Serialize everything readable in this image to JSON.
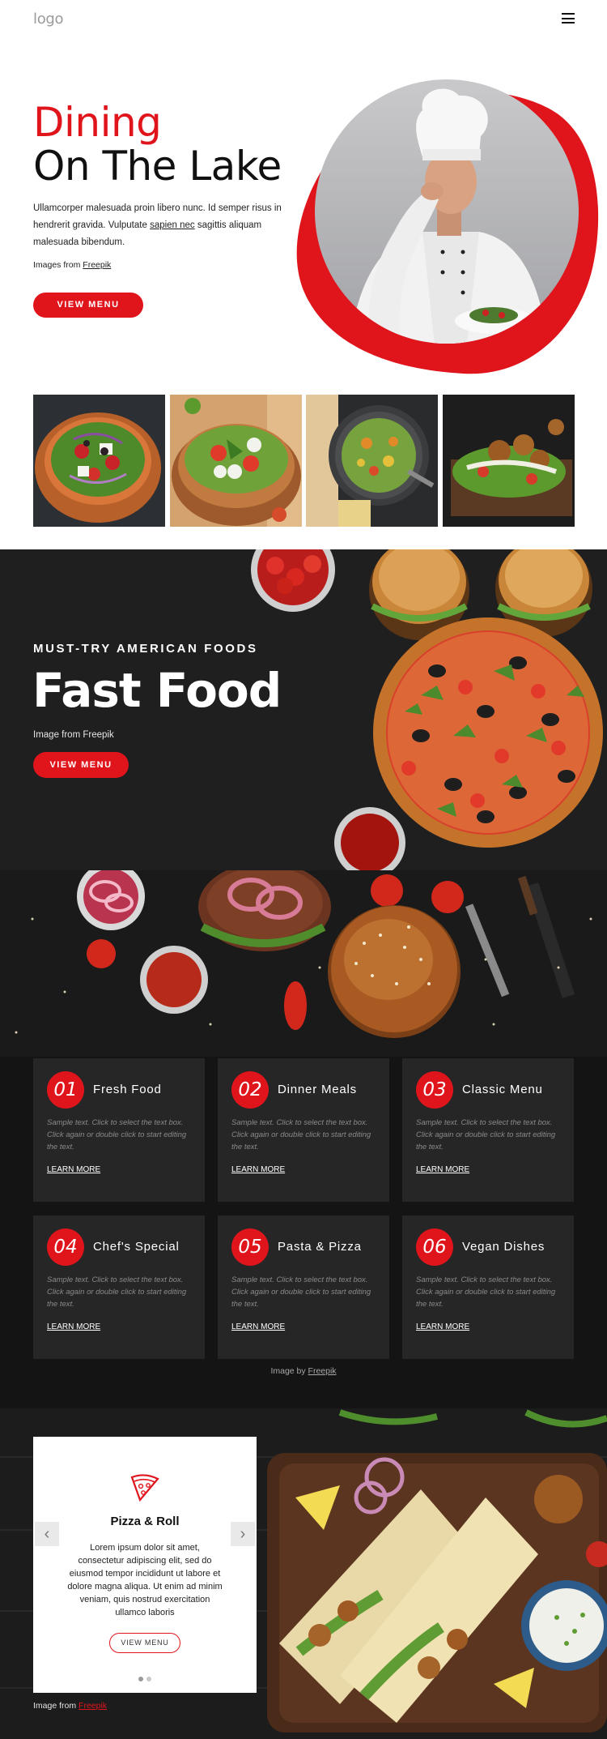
{
  "header": {
    "logo": "logo",
    "menu_icon": "hamburger-icon"
  },
  "hero": {
    "title_line1": "Dining",
    "title_line2": "On The Lake",
    "text_before": "Ullamcorper malesuada proin libero nunc. Id semper risus in hendrerit gravida. Vulputate ",
    "text_link": "sapien nec",
    "text_after": " sagittis aliquam malesuada bibendum.",
    "credit_prefix": "Images from ",
    "credit_link": "Freepik",
    "button": "VIEW MENU"
  },
  "fast_food": {
    "subtitle": "MUST-TRY AMERICAN FOODS",
    "title": "Fast Food",
    "credit": "Image from Freepik",
    "button": "VIEW MENU"
  },
  "features": {
    "cards": [
      {
        "num": "01",
        "title": "Fresh Food",
        "desc": "Sample text. Click to select the text box. Click again or double click to start editing the text.",
        "link": "LEARN MORE"
      },
      {
        "num": "02",
        "title": "Dinner Meals",
        "desc": "Sample text. Click to select the text box. Click again or double click to start editing the text.",
        "link": "LEARN MORE"
      },
      {
        "num": "03",
        "title": "Classic Menu",
        "desc": "Sample text. Click to select the text box. Click again or double click to start editing the text.",
        "link": "LEARN MORE"
      },
      {
        "num": "04",
        "title": "Chef's Special",
        "desc": "Sample text. Click to select the text box. Click again or double click to start editing the text.",
        "link": "LEARN MORE"
      },
      {
        "num": "05",
        "title": "Pasta & Pizza",
        "desc": "Sample text. Click to select the text box. Click again or double click to start editing the text.",
        "link": "LEARN MORE"
      },
      {
        "num": "06",
        "title": "Vegan Dishes",
        "desc": "Sample text. Click to select the text box. Click again or double click to start editing the text.",
        "link": "LEARN MORE"
      }
    ],
    "credit_prefix": "Image by ",
    "credit_link": "Freepik"
  },
  "pizza_roll": {
    "icon": "pizza-slice-icon",
    "title": "Pizza & Roll",
    "text": "Lorem ipsum dolor sit amet, consectetur adipiscing elit, sed do eiusmod tempor incididunt ut labore et dolore magna aliqua. Ut enim ad minim veniam, quis nostrud exercitation ullamco laboris",
    "button": "VIEW MENU",
    "credit_prefix": "Image from ",
    "credit_link": "Freepik"
  },
  "colors": {
    "accent": "#e0151c",
    "dark": "#1f1f20",
    "card": "#262627"
  }
}
